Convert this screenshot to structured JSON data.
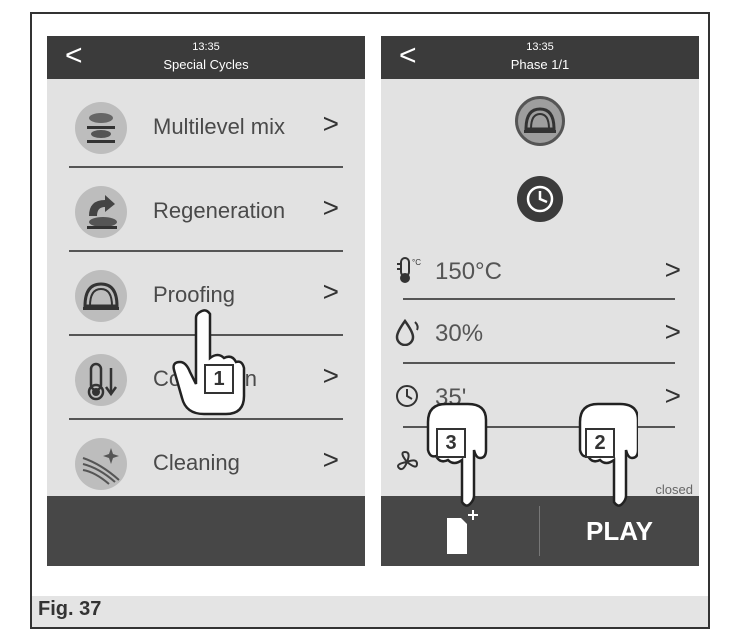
{
  "caption": "Fig. 37",
  "left_screen": {
    "time": "13:35",
    "title": "Special Cycles",
    "items": [
      {
        "label": "Multilevel mix",
        "icon": "multilevel-icon"
      },
      {
        "label": "Regeneration",
        "icon": "regeneration-icon"
      },
      {
        "label": "Proofing",
        "icon": "proofing-icon"
      },
      {
        "label": "Cool down",
        "icon": "cool-down-icon"
      },
      {
        "label": "Cleaning",
        "icon": "cleaning-icon"
      }
    ]
  },
  "right_screen": {
    "time": "13:35",
    "title": "Phase 1/1",
    "temperature": "150°C",
    "humidity": "30%",
    "time_value": "35'",
    "steam_status": "closed",
    "play_label": "PLAY"
  },
  "callouts": [
    "1",
    "2",
    "3"
  ],
  "chevron": ">",
  "back": "<"
}
